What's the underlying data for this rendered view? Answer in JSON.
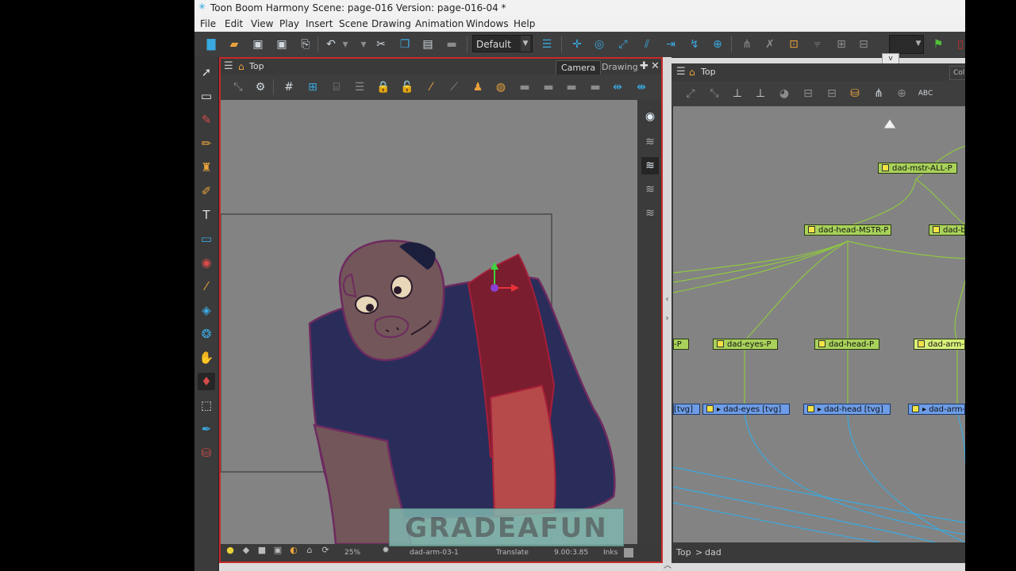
{
  "window": {
    "title": "Toon Boom Harmony Scene: page-016 Version: page-016-04 *"
  },
  "menu": [
    "File",
    "Edit",
    "View",
    "Play",
    "Insert",
    "Scene",
    "Drawing",
    "Animation",
    "Windows",
    "Help"
  ],
  "main_toolbar": {
    "preset": "Default"
  },
  "camera_view": {
    "breadcrumb": "Top",
    "tabs": [
      "Camera",
      "Drawing"
    ],
    "active_tab": "Camera",
    "status": {
      "zoom": "25%",
      "drawing": "dad-arm-03-1",
      "tool": "Translate",
      "coords": "9.00:3.85",
      "mode": "Inks"
    }
  },
  "watermark": "GRADEAFUN",
  "node_view": {
    "breadcrumb": "Top",
    "tab_partial": "Col",
    "nodes": {
      "master": "dad-mstr-ALL-P",
      "head_master": "dad-head-MSTR-P",
      "right_peg_partial": "dad-b",
      "left_partial_peg": "-P",
      "eyes_peg": "dad-eyes-P",
      "head_peg": "dad-head-P",
      "arm_peg_partial": "dad-arm-0",
      "left_partial_elem": "[tvg]",
      "eyes_elem": "dad-eyes [tvg]",
      "head_elem": "dad-head [tvg]",
      "arm_elem_partial": "dad-arm-"
    },
    "path": {
      "root": "Top",
      "separator": ">",
      "current": "dad"
    }
  },
  "colors": {
    "accent_red": "#c72a2a",
    "peg_green": "#a9d25b",
    "element_blue": "#6e9ce6",
    "wire_green": "#8fc740",
    "wire_blue": "#3aa9e0"
  }
}
